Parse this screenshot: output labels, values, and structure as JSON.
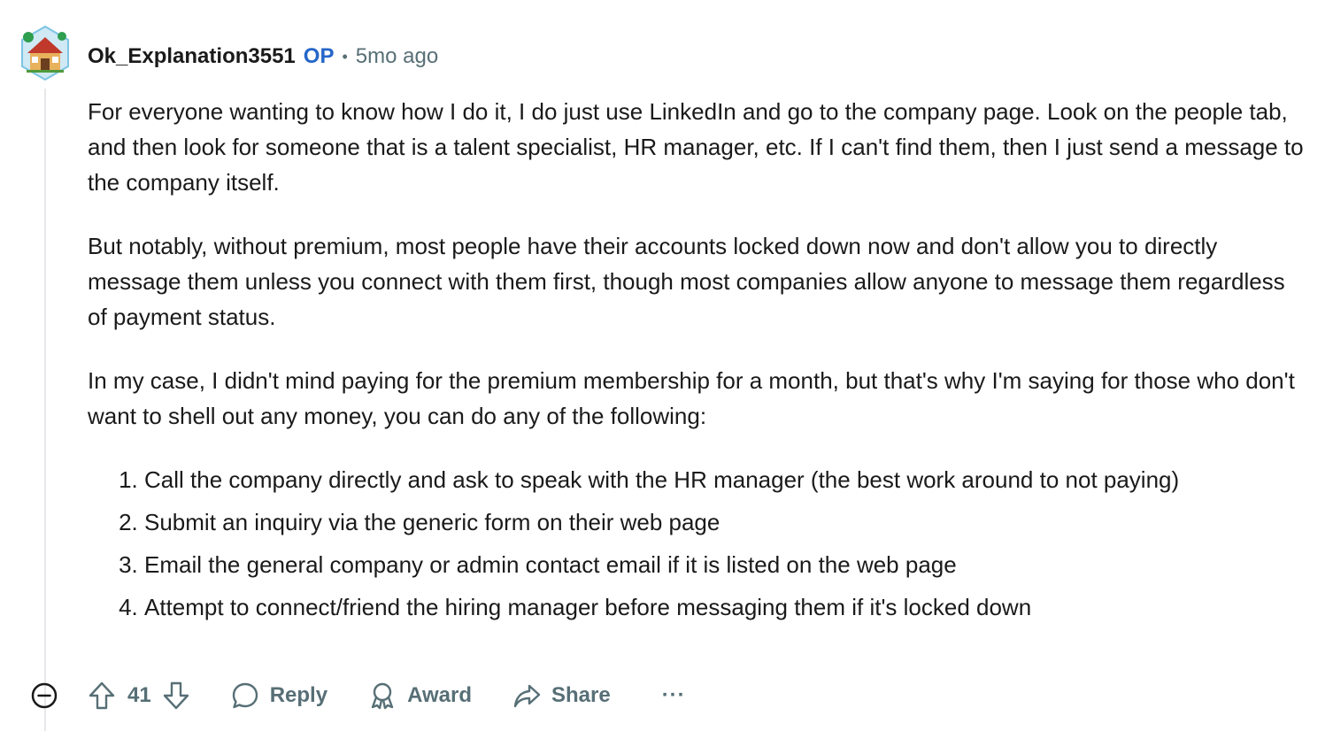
{
  "comment": {
    "author": "Ok_Explanation3551",
    "op_badge": "OP",
    "separator": "•",
    "time_ago": "5mo ago",
    "paragraphs": [
      "For everyone wanting to know how I do it, I do just use LinkedIn and go to the company page. Look on the people tab, and then look for someone that is a talent specialist, HR manager, etc. If I can't find them, then I just send a message to the company itself.",
      "But notably, without premium, most people have their accounts locked down now and don't allow you to directly message them unless you connect with them first, though most companies allow anyone to message them regardless of payment status.",
      "In my case, I didn't mind paying for the premium membership for a month, but that's why I'm saying for those who don't want to shell out any money, you can do any of the following:"
    ],
    "list_items": [
      "Call the company directly and ask to speak with the HR manager (the best work around to not paying)",
      "Submit an inquiry via the generic form on their web page",
      "Email the general company or admin contact email if it is listed on the web page",
      "Attempt to connect/friend the hiring manager before messaging them if it's locked down"
    ]
  },
  "actions": {
    "vote_count": "41",
    "reply_label": "Reply",
    "award_label": "Award",
    "share_label": "Share",
    "more_label": "···"
  },
  "icons": {
    "collapse": "minus-circle-icon",
    "upvote": "arrow-up-icon",
    "downvote": "arrow-down-icon",
    "reply": "speech-bubble-icon",
    "award": "award-ribbon-icon",
    "share": "share-arrow-icon"
  },
  "colors": {
    "op_badge": "#2466c9",
    "meta_text": "#576f76",
    "body_text": "#1a1a1b",
    "thread_line": "#e6e8ea"
  }
}
